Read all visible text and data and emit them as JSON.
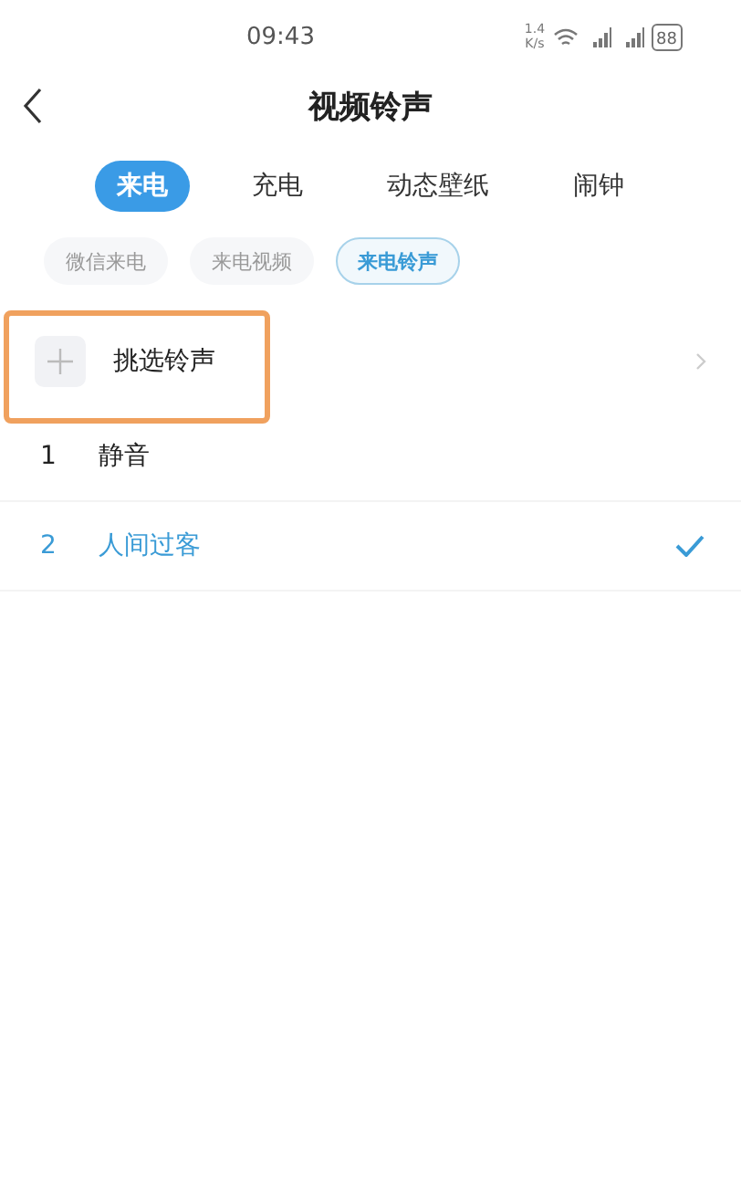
{
  "status_bar": {
    "time": "09:43",
    "speed": "1.4",
    "speed_unit": "K/s",
    "battery": "88"
  },
  "header": {
    "title": "视频铃声"
  },
  "tabs": [
    {
      "label": "来电",
      "selected": true
    },
    {
      "label": "充电",
      "selected": false
    },
    {
      "label": "动态壁纸",
      "selected": false
    },
    {
      "label": "闹钟",
      "selected": false
    }
  ],
  "subtabs": [
    {
      "label": "微信来电",
      "selected": false
    },
    {
      "label": "来电视频",
      "selected": false
    },
    {
      "label": "来电铃声",
      "selected": true
    }
  ],
  "pick_row": {
    "label": "挑选铃声",
    "highlighted": true
  },
  "ringtones": [
    {
      "index": "1",
      "name": "静音",
      "selected": false
    },
    {
      "index": "2",
      "name": "人间过客",
      "selected": true
    }
  ]
}
